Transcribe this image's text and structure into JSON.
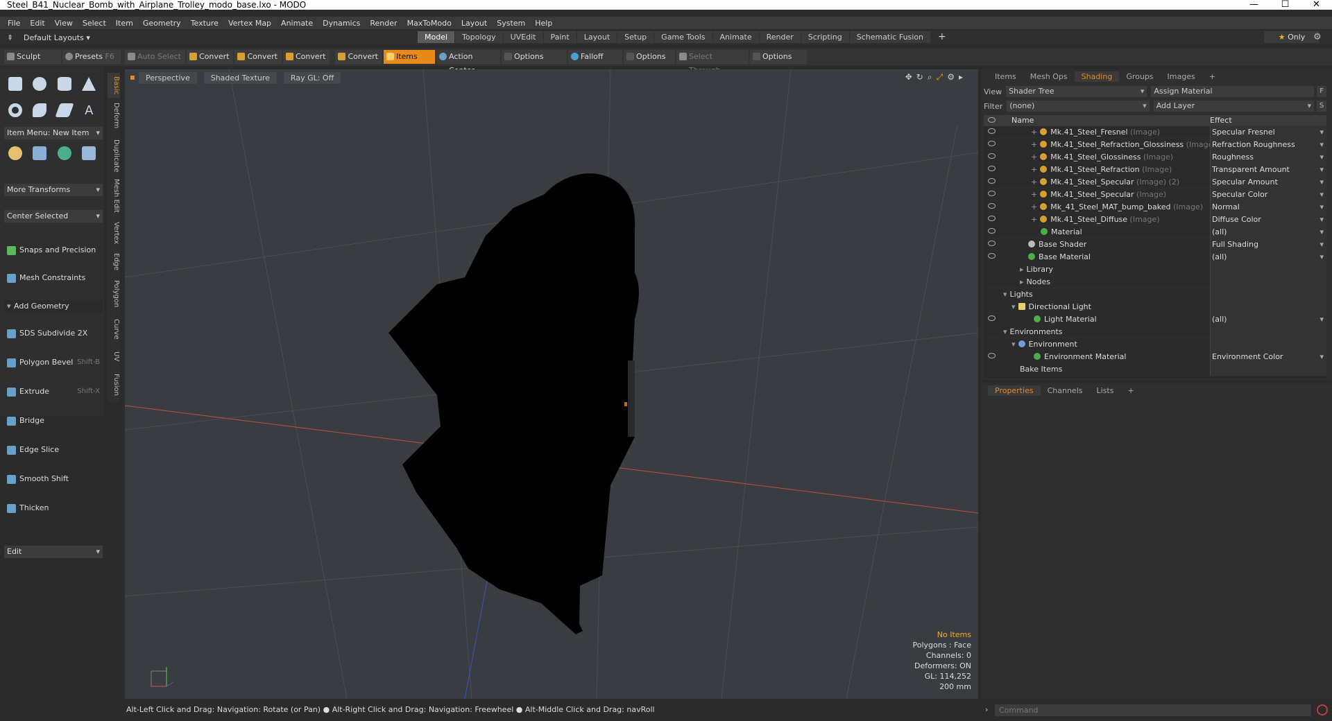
{
  "window": {
    "title": "Steel_B41_Nuclear_Bomb_with_Airplane_Trolley_modo_base.lxo - MODO"
  },
  "menu": [
    "File",
    "Edit",
    "View",
    "Select",
    "Item",
    "Geometry",
    "Texture",
    "Vertex Map",
    "Animate",
    "Dynamics",
    "Render",
    "MaxToModo",
    "Layout",
    "System",
    "Help"
  ],
  "layouts": {
    "label": "Default Layouts"
  },
  "tabs": [
    "Model",
    "Topology",
    "UVEdit",
    "Paint",
    "Layout",
    "Setup",
    "Game Tools",
    "Animate",
    "Render",
    "Scripting",
    "Schematic Fusion",
    "+"
  ],
  "only_label": "Only",
  "toolbar": {
    "sculpt": "Sculpt",
    "presets": "Presets",
    "presets_key": "F6",
    "auto_select": "Auto Select",
    "convert1": "Convert",
    "convert2": "Convert",
    "convert3": "Convert",
    "convert4": "Convert",
    "items": "Items",
    "action_center": "Action Center",
    "options1": "Options",
    "falloff": "Falloff",
    "options2": "Options",
    "select_through": "Select Through",
    "options3": "Options"
  },
  "left": {
    "item_menu": "Item Menu: New Item",
    "more_transforms": "More Transforms",
    "center_selected": "Center Selected",
    "snaps": "Snaps and Precision",
    "mesh_constraints": "Mesh Constraints",
    "add_geometry": "Add Geometry",
    "tools": [
      {
        "label": "SDS Subdivide 2X",
        "shortcut": ""
      },
      {
        "label": "Polygon Bevel",
        "shortcut": "Shift-B"
      },
      {
        "label": "Extrude",
        "shortcut": "Shift-X"
      },
      {
        "label": "Bridge",
        "shortcut": ""
      },
      {
        "label": "Edge Slice",
        "shortcut": ""
      },
      {
        "label": "Smooth Shift",
        "shortcut": ""
      },
      {
        "label": "Thicken",
        "shortcut": ""
      }
    ],
    "edit": "Edit"
  },
  "vtabs": [
    "Basic",
    "Deform",
    "Duplicate",
    "Mesh Edit",
    "Vertex",
    "Edge",
    "Polygon",
    "Curve",
    "UV",
    "Fusion"
  ],
  "viewport": {
    "perspective": "Perspective",
    "shading": "Shaded Texture",
    "raygl": "Ray GL: Off",
    "stats": {
      "no_items": "No Items",
      "polygons": "Polygons : Face",
      "channels": "Channels: 0",
      "deformers": "Deformers: ON",
      "gl": "GL: 114,252",
      "scale": "200 mm"
    }
  },
  "status": "Alt-Left Click and Drag: Navigation: Rotate (or Pan) ● Alt-Right Click and Drag: Navigation: Freewheel ● Alt-Middle Click and Drag: navRoll",
  "right": {
    "tabs": [
      "Items",
      "Mesh Ops",
      "Shading",
      "Groups",
      "Images",
      "+"
    ],
    "view_label": "View",
    "view_value": "Shader Tree",
    "assign": "Assign Material",
    "assign_btn": "F",
    "filter_label": "Filter",
    "filter_value": "(none)",
    "add_layer": "Add Layer",
    "add_layer_btn": "S",
    "col_name": "Name",
    "col_effect": "Effect",
    "rows": [
      {
        "name": "Mk.41_Steel_Fresnel",
        "sub": "(Image)",
        "effect": "Specular Fresnel"
      },
      {
        "name": "Mk.41_Steel_Refraction_Glossiness",
        "sub": "(Image)",
        "effect": "Refraction Roughness"
      },
      {
        "name": "Mk.41_Steel_Glossiness",
        "sub": "(Image)",
        "effect": "Roughness"
      },
      {
        "name": "Mk.41_Steel_Refraction",
        "sub": "(Image)",
        "effect": "Transparent Amount"
      },
      {
        "name": "Mk.41_Steel_Specular",
        "sub": "(Image) (2)",
        "effect": "Specular Amount"
      },
      {
        "name": "Mk.41_Steel_Specular",
        "sub": "(Image)",
        "effect": "Specular Color"
      },
      {
        "name": "Mk_41_Steel_MAT_bump_baked",
        "sub": "(Image)",
        "effect": "Normal"
      },
      {
        "name": "Mk.41_Steel_Diffuse",
        "sub": "(Image)",
        "effect": "Diffuse Color"
      },
      {
        "name": "Material",
        "sub": "",
        "effect": "(all)"
      },
      {
        "name": "Base Shader",
        "sub": "",
        "effect": "Full Shading"
      },
      {
        "name": "Base Material",
        "sub": "",
        "effect": "(all)"
      },
      {
        "name": "Library",
        "sub": "",
        "effect": ""
      },
      {
        "name": "Nodes",
        "sub": "",
        "effect": ""
      },
      {
        "name": "Lights",
        "sub": "",
        "effect": ""
      },
      {
        "name": "Directional Light",
        "sub": "",
        "effect": ""
      },
      {
        "name": "Light Material",
        "sub": "",
        "effect": "(all)"
      },
      {
        "name": "Environments",
        "sub": "",
        "effect": ""
      },
      {
        "name": "Environment",
        "sub": "",
        "effect": ""
      },
      {
        "name": "Environment Material",
        "sub": "",
        "effect": "Environment Color"
      },
      {
        "name": "Bake Items",
        "sub": "",
        "effect": ""
      }
    ]
  },
  "props_tabs": [
    "Properties",
    "Channels",
    "Lists",
    "+"
  ],
  "command_placeholder": "Command"
}
